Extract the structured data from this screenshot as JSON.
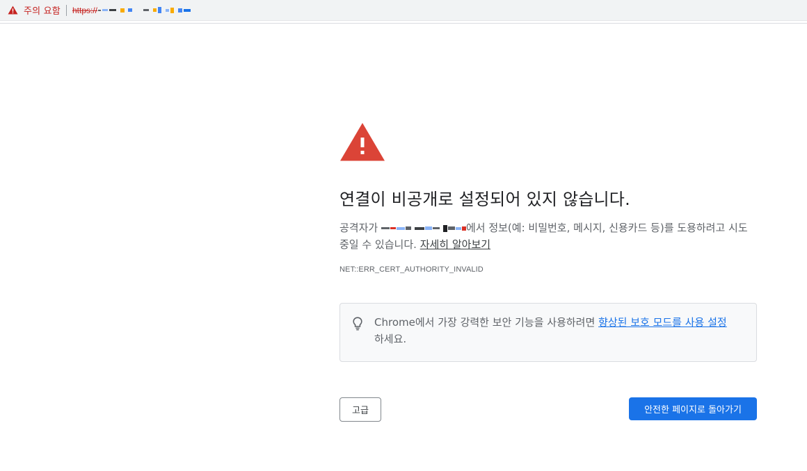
{
  "omnibox": {
    "security_label": "주의 요함",
    "url_scheme": "https://",
    "url_host_redacted": true
  },
  "interstitial": {
    "heading": "연결이 비공개로 설정되어 있지 않습니다.",
    "explanation_before": "공격자가 ",
    "explanation_after": "에서 정보(예: 비밀번호, 메시지, 신용카드 등)를 도용하려고 시도 중일 수 있습니다. ",
    "learn_more_link": "자세히 알아보기",
    "error_code": "NET::ERR_CERT_AUTHORITY_INVALID",
    "promo": {
      "text_before": "Chrome에서 가장 강력한 보안 기능을 사용하려면 ",
      "link": "향상된 보호 모드를 사용 설정",
      "text_after": "하세요."
    },
    "advanced_button": "고급",
    "back_button": "안전한 페이지로 돌아가기"
  },
  "colors": {
    "danger_red": "#c5221f",
    "warning_icon_red": "#db4437",
    "primary_blue": "#1a73e8"
  },
  "icons": {
    "omnibox_warning": "warning-triangle-icon",
    "main_warning": "warning-triangle-icon",
    "promo_bulb": "lightbulb-icon"
  }
}
